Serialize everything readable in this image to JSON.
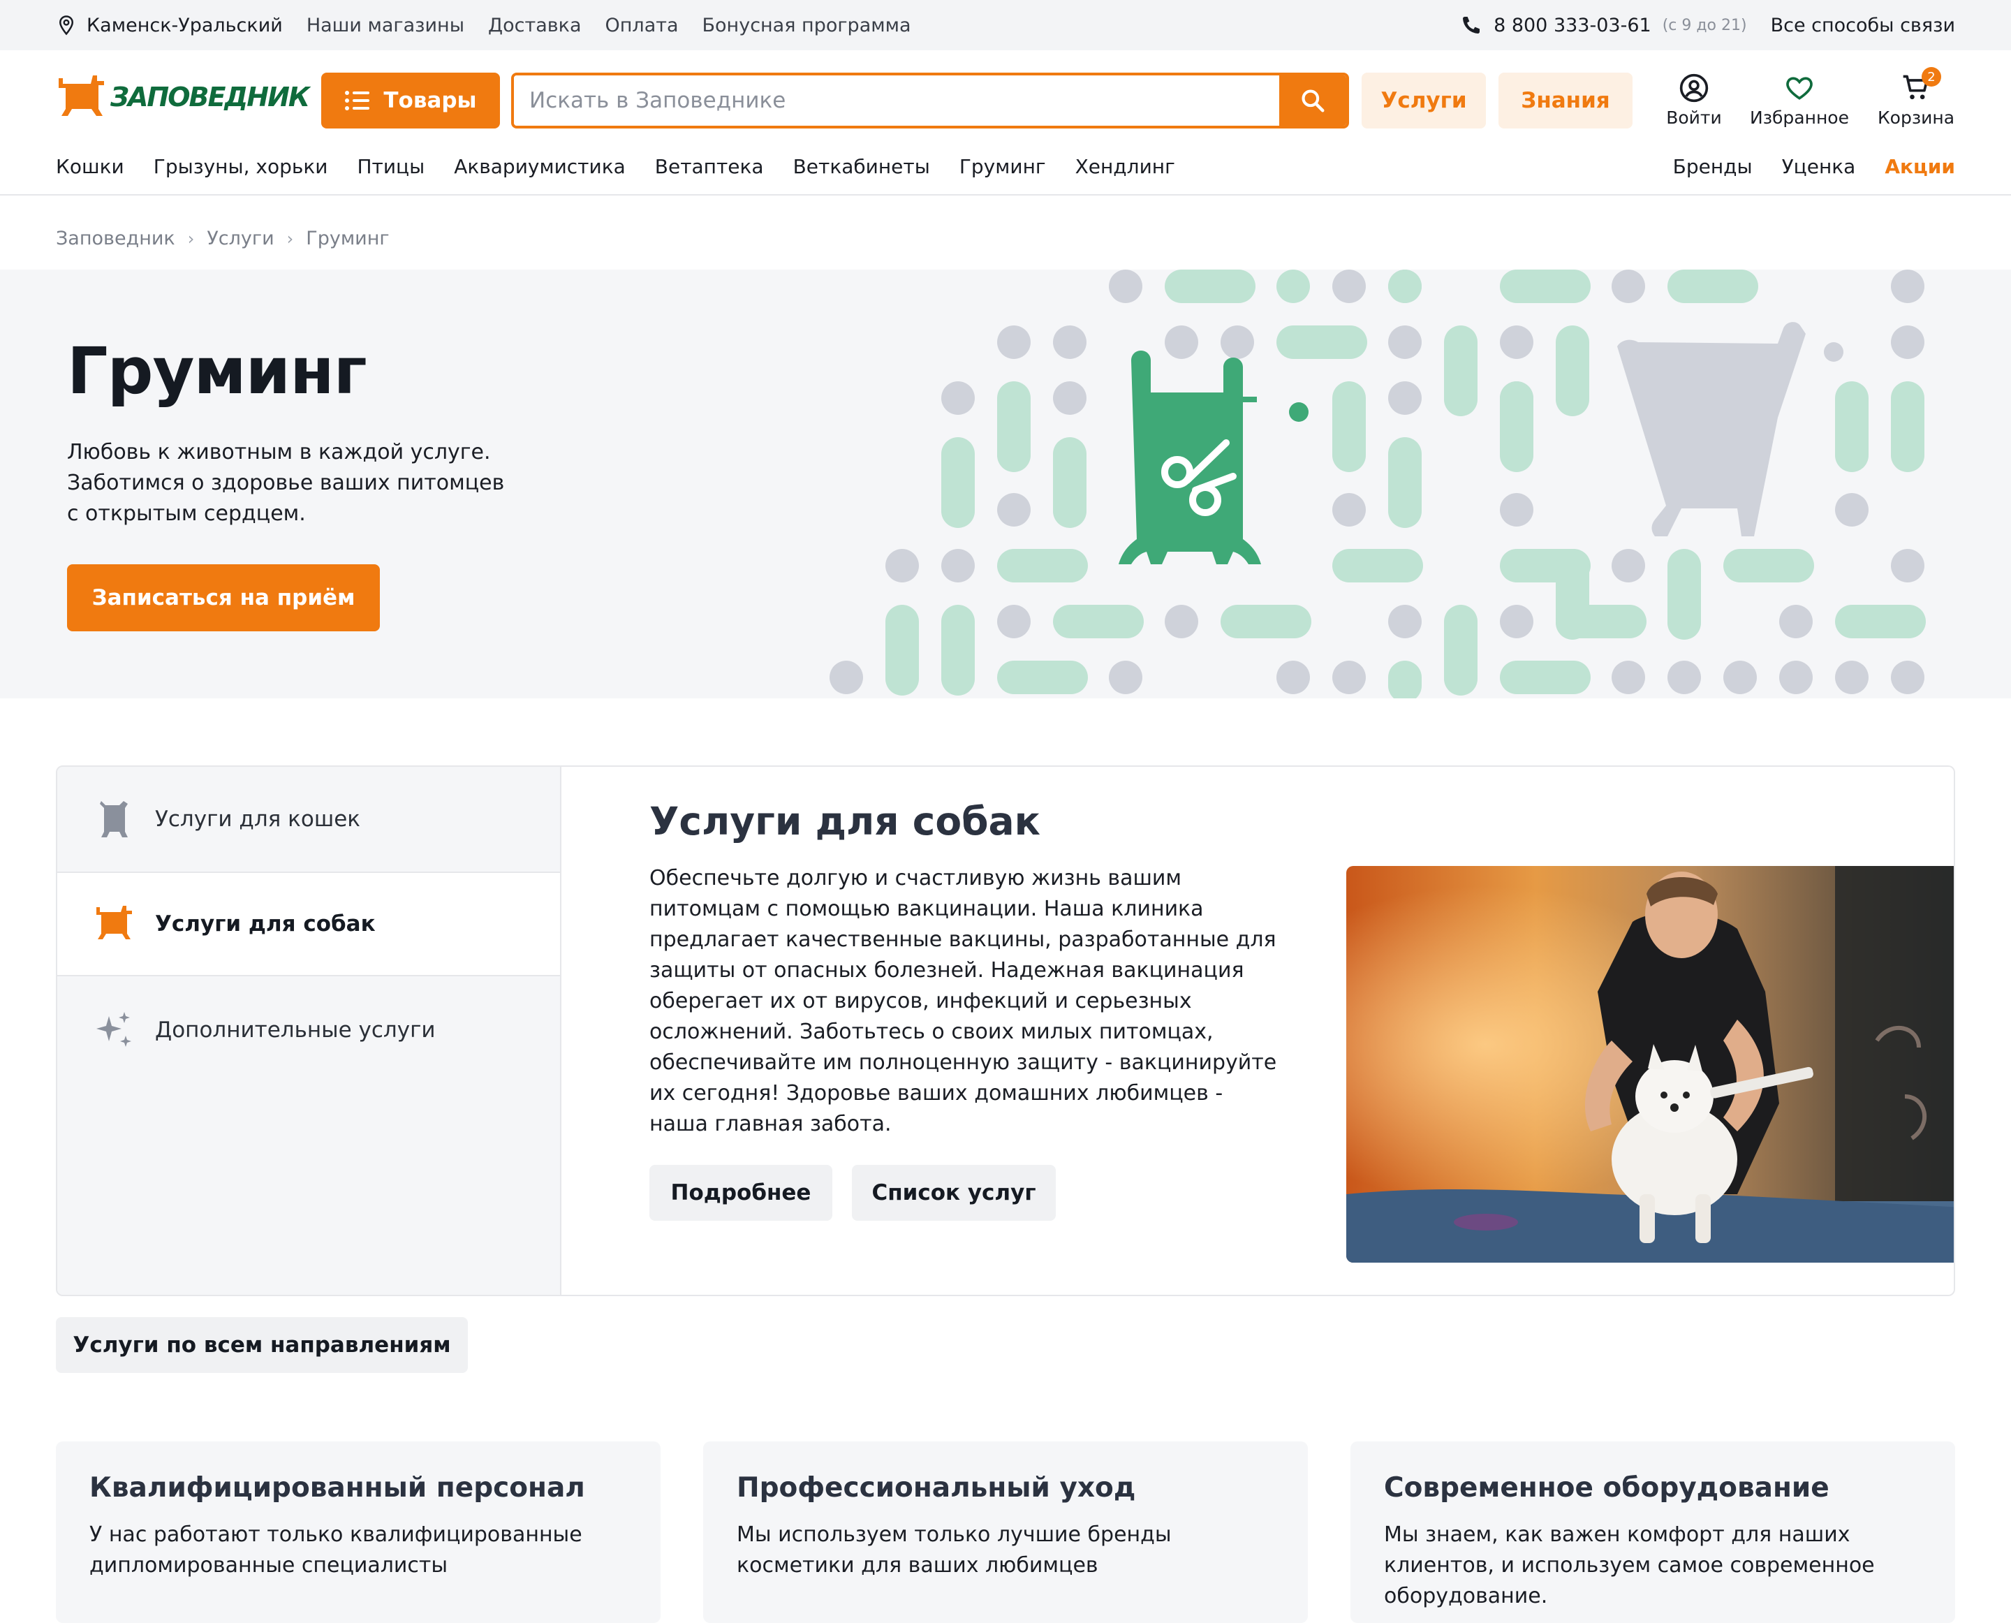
{
  "topbar": {
    "city": "Каменск-Уральский",
    "links": [
      "Наши магазины",
      "Доставка",
      "Оплата",
      "Бонусная программа"
    ],
    "phone": "8 800 333-03-61",
    "hours": "(с 9 до 21)",
    "contacts": "Все способы связи"
  },
  "header": {
    "logo_text": "ЗАПОВЕДНИК",
    "goods_button": "Товары",
    "search_placeholder": "Искать в Заповеднике",
    "services_button": "Услуги",
    "knowledge_button": "Знания",
    "login_label": "Войти",
    "favorites_label": "Избранное",
    "cart_label": "Корзина",
    "cart_count": "2"
  },
  "nav": {
    "categories": [
      "Кошки",
      "Грызуны, хорьки",
      "Птицы",
      "Аквариумистика",
      "Ветаптека",
      "Веткабинеты",
      "Груминг",
      "Хендлинг"
    ],
    "brands": "Бренды",
    "discount": "Уценка",
    "promo": "Акции"
  },
  "breadcrumb": [
    "Заповедник",
    "Услуги",
    "Груминг"
  ],
  "hero": {
    "title": "Груминг",
    "subtitle_lines": [
      "Любовь к животным в каждой услуге.",
      "Заботимся о здоровье ваших питомцев",
      "с открытым сердцем."
    ],
    "cta": "Записаться на приём"
  },
  "services": {
    "sidebar": [
      {
        "label": "Услуги для кошек",
        "icon": "cat-icon"
      },
      {
        "label": "Услуги для собак",
        "icon": "dog-icon"
      },
      {
        "label": "Дополнительные услуги",
        "icon": "sparkle-icon"
      }
    ],
    "active_title": "Услуги для собак",
    "description_lines": [
      "Обеспечьте долгую и счастливую жизнь вашим",
      "питомцам с помощью вакцинации. Наша клиника",
      "предлагает качественные вакцины, разработанные для",
      "защиты от опасных болезней. Надежная вакцинация",
      "оберегает их от вирусов, инфекций и серьезных",
      "осложнений. Заботьтесь о своих милых питомцах,",
      "обеспечивайте им полноценную защиту - вакцинируйте",
      "их сегодня! Здоровье ваших домашних любимцев -",
      "наша главная забота."
    ],
    "more_button": "Подробнее",
    "list_button": "Список услуг"
  },
  "all_services_button": "Услуги по всем направлениям",
  "features": [
    {
      "title": "Квалифицированный персонал",
      "text_lines": [
        "У нас работают только квалифицированные",
        "дипломированные специалисты"
      ]
    },
    {
      "title": "Профессиональный уход",
      "text_lines": [
        "Мы используем только лучшие бренды",
        "косметики для ваших любимцев"
      ]
    },
    {
      "title": "Современное оборудование",
      "text_lines": [
        "Мы знаем, как важен комфорт для наших",
        "клиентов, и используем самое современное",
        "оборудование."
      ]
    }
  ],
  "colors": {
    "accent": "#f07a10",
    "brand_green": "#0f6b3c",
    "hero_green": "#3fa977",
    "pattern_green": "#bfe3d3",
    "pattern_gray": "#cfd2da"
  }
}
